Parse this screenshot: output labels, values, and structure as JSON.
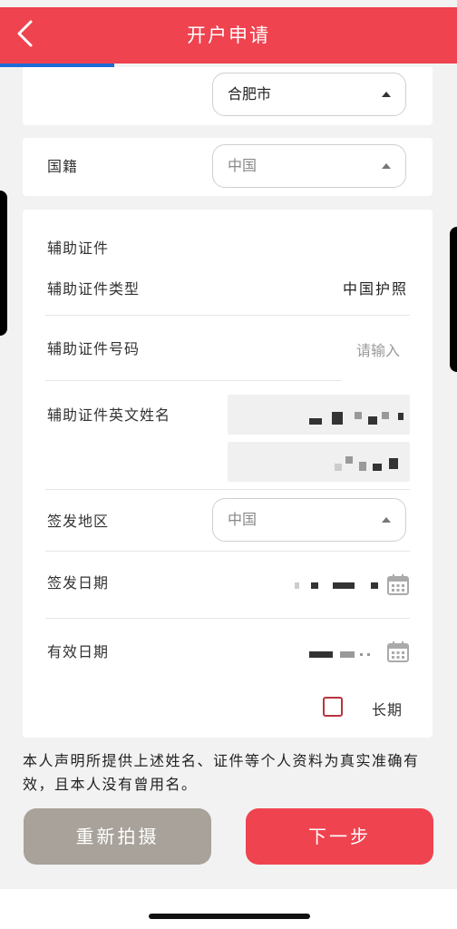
{
  "header": {
    "title": "开户申请",
    "back_icon": "chevron-left-icon",
    "color": "#ef4350"
  },
  "progress": {
    "fraction": 0.25,
    "color": "#1e6bd6"
  },
  "city_select": {
    "value": "合肥市"
  },
  "nationality": {
    "label": "国籍",
    "value": "中国"
  },
  "aux_id": {
    "section_title": "辅助证件",
    "type_label": "辅助证件类型",
    "type_value": "中国护照",
    "number_label": "辅助证件号码",
    "number_placeholder": "请输入",
    "english_name_label": "辅助证件英文姓名",
    "issue_region_label": "签发地区",
    "issue_region_value": "中国",
    "issue_date_label": "签发日期",
    "expiry_date_label": "有效日期",
    "long_term_label": "长期"
  },
  "declaration": "本人声明所提供上述姓名、证件等个人资料为真实准确有效，且本人没有曾用名。",
  "buttons": {
    "retake": "重新拍摄",
    "next": "下一步"
  }
}
